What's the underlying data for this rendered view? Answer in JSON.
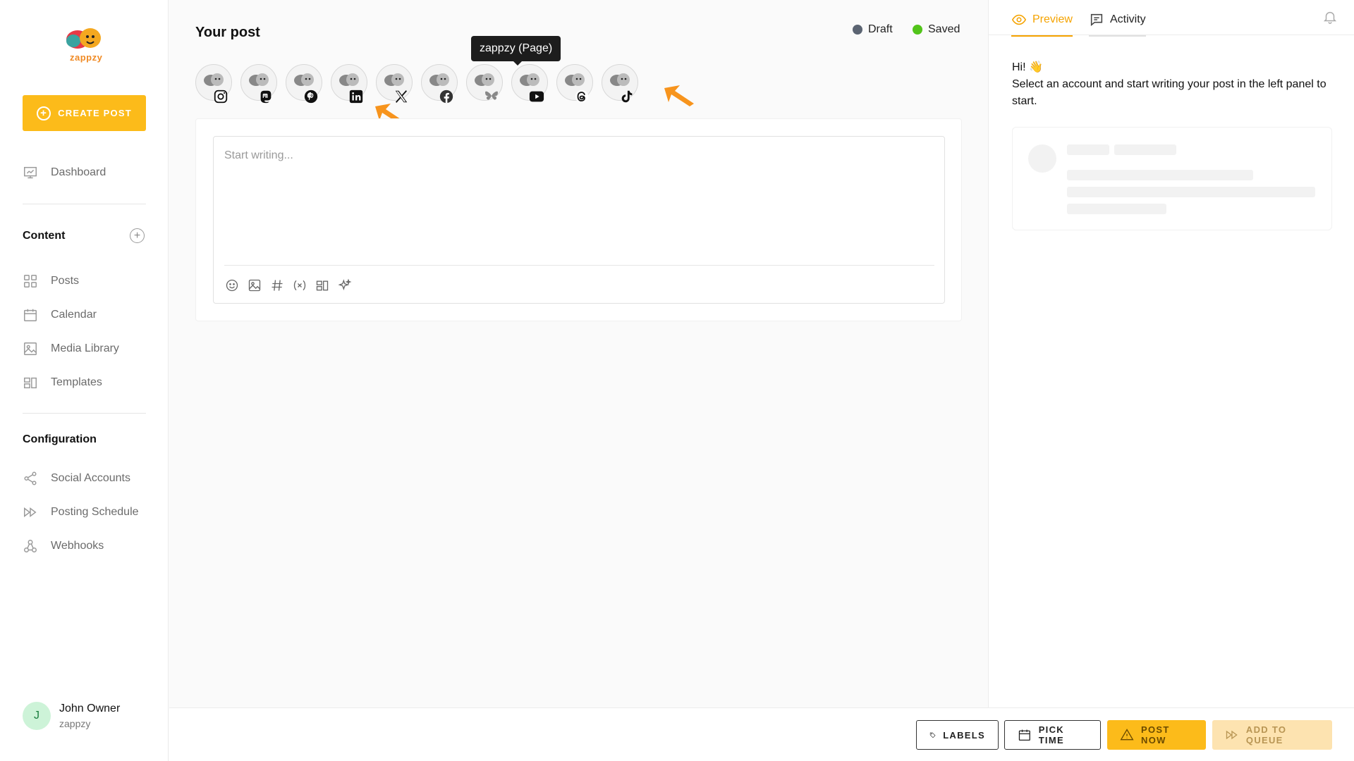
{
  "app": {
    "logo_text": "zappzy"
  },
  "sidebar": {
    "create_label": "CREATE POST",
    "dashboard": "Dashboard",
    "content_title": "Content",
    "content_items": [
      {
        "label": "Posts",
        "icon": "grid-icon"
      },
      {
        "label": "Calendar",
        "icon": "calendar-icon"
      },
      {
        "label": "Media Library",
        "icon": "image-icon"
      },
      {
        "label": "Templates",
        "icon": "template-icon"
      }
    ],
    "config_title": "Configuration",
    "config_items": [
      {
        "label": "Social Accounts",
        "icon": "share-icon"
      },
      {
        "label": "Posting Schedule",
        "icon": "schedule-icon"
      },
      {
        "label": "Webhooks",
        "icon": "webhook-icon"
      }
    ],
    "user": {
      "initial": "J",
      "name": "John Owner",
      "org": "zappzy"
    }
  },
  "main": {
    "title": "Your post",
    "status": [
      {
        "label": "Draft",
        "color": "#5b6472"
      },
      {
        "label": "Saved",
        "color": "#52c41a"
      }
    ],
    "accounts": [
      {
        "network": "instagram"
      },
      {
        "network": "mastodon"
      },
      {
        "network": "pinterest"
      },
      {
        "network": "linkedin"
      },
      {
        "network": "x"
      },
      {
        "network": "facebook"
      },
      {
        "network": "bluesky"
      },
      {
        "network": "youtube"
      },
      {
        "network": "threads"
      },
      {
        "network": "tiktok"
      }
    ],
    "tooltip": "zappzy (Page)",
    "editor": {
      "placeholder": "Start writing...",
      "tools": [
        "emoji-icon",
        "image-icon",
        "hashtag-icon",
        "variable-icon",
        "template-icon",
        "ai-sparkle-icon"
      ]
    }
  },
  "preview": {
    "tab_preview": "Preview",
    "tab_activity": "Activity",
    "hi": "Hi! 👋",
    "instructions": "Select an account and start writing your post in the left panel to start."
  },
  "bottombar": {
    "labels": "LABELS",
    "pick_time": "PICK TIME",
    "post_now": "POST NOW",
    "add_to_queue": "ADD TO QUEUE"
  },
  "colors": {
    "accent": "#fcbb1a",
    "arrow": "#f7941d"
  }
}
